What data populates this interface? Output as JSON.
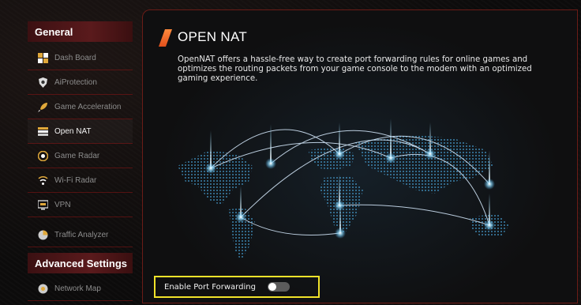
{
  "sidebar": {
    "general_header": "General",
    "items": [
      {
        "label": "Dash Board",
        "icon": "dashboard-icon"
      },
      {
        "label": "AiProtection",
        "icon": "shield-icon"
      },
      {
        "label": "Game Acceleration",
        "icon": "rocket-icon"
      },
      {
        "label": "Open NAT",
        "icon": "open-nat-icon",
        "active": true
      },
      {
        "label": "Game Radar",
        "icon": "radar-icon"
      },
      {
        "label": "Wi-Fi Radar",
        "icon": "wifi-radar-icon"
      },
      {
        "label": "VPN",
        "icon": "vpn-icon"
      },
      {
        "label": "Traffic Analyzer",
        "icon": "traffic-analyzer-icon"
      }
    ],
    "advanced_header": "Advanced Settings",
    "advanced_items": [
      {
        "label": "Network Map",
        "icon": "network-map-icon"
      }
    ]
  },
  "main": {
    "title": "OPEN NAT",
    "description": "OpenNAT offers a hassle-free way to create port forwarding rules for online games and optimizes the routing packets from your game console to the modem with an optimized gaming experience.",
    "toggle": {
      "label": "Enable Port Forwarding",
      "enabled": false
    }
  },
  "colors": {
    "accent_red": "#a31212",
    "highlight_yellow": "#f0e22a",
    "title_accent": "#e2501c",
    "map_glow": "#5fc6ff"
  }
}
